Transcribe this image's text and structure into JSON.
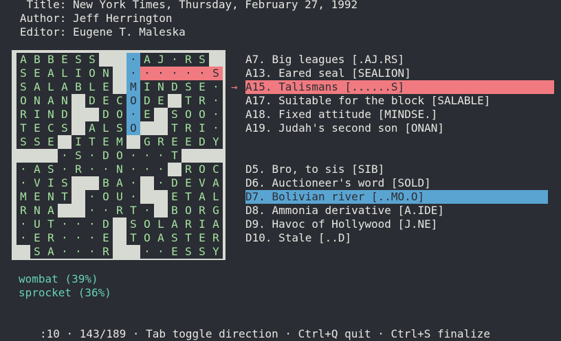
{
  "header": {
    "title_line": "    Title: New York Times, Thursday, February 27, 1992",
    "author_line": "   Author: Jeff Herrington",
    "editor_line": "   Editor: Eugene T. Maleska"
  },
  "grid": {
    "rows": [
      "ABBESS##.AJ.RS",
      "SEALION#......S",
      "SALABLE#MINDSE.",
      "ONAN#DECODE#TR.",
      "RIND##DO.E#SOO.",
      "TECS#ALSO##TRI.",
      "SSE#ITEM#GREEDY",
      "###.S.DO...T###",
      ".AS.R..N...#ROC",
      ".VIS##BA.#.DEVA",
      "MENT#.OU.##ETAL",
      "RNA##..RT.#BORG",
      ".UT...D#SOLARIA",
      ".ER...E#TOASTER",
      "#SA...R##..ESSY"
    ],
    "current_word": {
      "row": 1,
      "start": 8,
      "end": 14
    },
    "crossing_word": {
      "col": 8,
      "start": 0,
      "end": 5
    },
    "colors": {
      "grid_bg": "#d7dad2",
      "cell_bg": "#2a2d33",
      "letter": "#a6e3a1",
      "current": "#f07a80",
      "crossing": "#5aa4d2"
    }
  },
  "clues": {
    "across": [
      "A7. Big leagues [.AJ.RS]",
      "A13. Eared seal [SEALION]",
      "A15. Talismans [......S]",
      "A17. Suitable for the block [SALABLE]",
      "A18. Fixed attitude [MINDSE.]",
      "A19. Judah's second son [ONAN]"
    ],
    "down": [
      "D5. Bro, to sis [SIB]",
      "D6. Auctioneer's word [SOLD]",
      "D7. Bolivian river [..MO.O]",
      "D8. Ammonia derivative [A.IDE]",
      "D9. Havoc of Hollywood [J.NE]",
      "D10. Stale [..D]"
    ],
    "arrow": "→"
  },
  "suggestions": [
    "wombat (39%)",
    "sprocket (36%)"
  ],
  "status": ":10 · 143/189 · Tab toggle direction · Ctrl+Q quit · Ctrl+S finalize"
}
